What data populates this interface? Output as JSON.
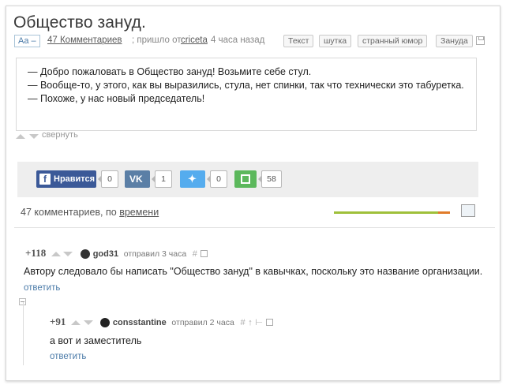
{
  "post": {
    "title": "Общество зануд.",
    "font_toggle": "Aa –",
    "comments_link": "47 Комментариев",
    "posted_text": "; пришло от",
    "author": "criceta",
    "time_ago": "4 часа назад",
    "tags": [
      "Текст",
      "шутка",
      "странный юмор",
      "Зануда"
    ],
    "story_lines": [
      "— Добро пожаловать в Общество зануд! Возьмите себе стул.",
      "— Вообще-то, у этого, как вы выразились, стула, нет спинки, так что технически это табуретка.",
      "— Похоже, у нас новый председатель!"
    ],
    "collapse_label": "свернуть"
  },
  "share": {
    "facebook_label": "Нравится",
    "facebook_count": "0",
    "vk_count": "1",
    "twitter_count": "0",
    "save_count": "58",
    "colors": {
      "facebook": "#3b5998",
      "vk": "#5b7fa6",
      "twitter": "#55acee",
      "save": "#5cb85c"
    }
  },
  "comments_header": {
    "count_text": "47 комментариев, по",
    "sort_link": "времени",
    "rating_progress": 0.9
  },
  "comments": [
    {
      "rating": "+118",
      "username": "god31",
      "posted": "отправил 3 часа",
      "text": "Автору следовало бы написать \"Общество зануд\" в кавычках, поскольку это название организации.",
      "reply_label": "ответить"
    },
    {
      "rating": "+91",
      "username": "consstantine",
      "posted": "отправил 2 часа",
      "text": "а вот и заместитель",
      "reply_label": "ответить"
    }
  ]
}
